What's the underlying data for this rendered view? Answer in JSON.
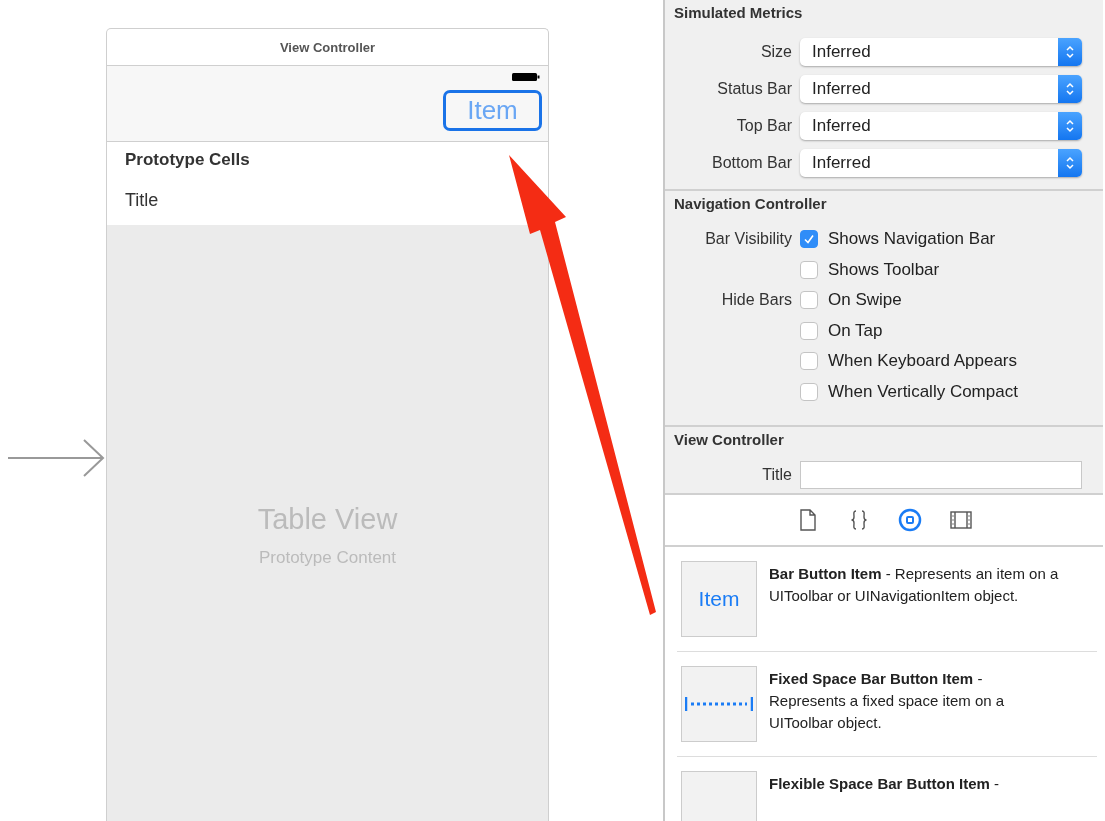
{
  "scene": {
    "title": "View Controller",
    "nav_button": "Item",
    "section_header": "Prototype Cells",
    "cell_title": "Title",
    "placeholder_title": "Table View",
    "placeholder_subtitle": "Prototype Content"
  },
  "inspector": {
    "simulated_metrics": {
      "title": "Simulated Metrics",
      "rows": [
        {
          "label": "Size",
          "value": "Inferred"
        },
        {
          "label": "Status Bar",
          "value": "Inferred"
        },
        {
          "label": "Top Bar",
          "value": "Inferred"
        },
        {
          "label": "Bottom Bar",
          "value": "Inferred"
        }
      ]
    },
    "navigation_controller": {
      "title": "Navigation Controller",
      "options": [
        {
          "group_label": "Bar Visibility",
          "label": "Shows Navigation Bar",
          "checked": true
        },
        {
          "label": "Shows Toolbar",
          "checked": false
        },
        {
          "group_label": "Hide Bars",
          "label": "On Swipe",
          "checked": false
        },
        {
          "label": "On Tap",
          "checked": false
        },
        {
          "label": "When Keyboard Appears",
          "checked": false
        },
        {
          "label": "When Vertically Compact",
          "checked": false
        }
      ]
    },
    "view_controller": {
      "title": "View Controller",
      "field_label": "Title"
    }
  },
  "library": {
    "tabs": [
      {
        "kind": "file",
        "selected": false
      },
      {
        "kind": "braces",
        "selected": false
      },
      {
        "kind": "object",
        "selected": true
      },
      {
        "kind": "media",
        "selected": false
      }
    ],
    "items": [
      {
        "kind": "text",
        "icon_text": "Item",
        "description": "**Bar Button Item** - Represents an item on a UIToolbar or UINavigationItem object."
      },
      {
        "kind": "fixed-space",
        "description": "**Fixed Space Bar Button Item** - Represents a fixed space item on a UIToolbar object."
      },
      {
        "kind": "blank",
        "description": "**Flexible Space Bar Button Item** -"
      }
    ]
  }
}
